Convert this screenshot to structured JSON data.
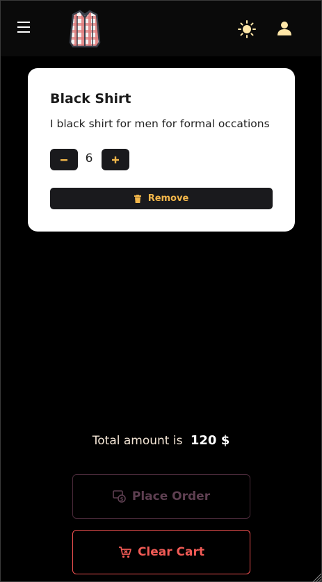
{
  "navbar": {
    "menu_icon": "hamburger-menu-icon",
    "logo_icon": "plaid-shirt-logo-icon",
    "theme_icon": "sun-icon",
    "user_icon": "user-icon"
  },
  "cart_item": {
    "title": "Black Shirt",
    "description": "I black shirt for men for formal occations",
    "quantity": "6",
    "minus_icon": "minus-icon",
    "plus_icon": "plus-icon",
    "remove_label": "Remove",
    "remove_icon": "trash-icon"
  },
  "summary": {
    "total_label": "Total amount is",
    "total_value": "120 $"
  },
  "actions": {
    "place_order_label": "Place Order",
    "place_order_icon": "money-check-icon",
    "clear_cart_label": "Clear Cart",
    "clear_cart_icon": "cart-remove-icon"
  },
  "colors": {
    "background": "#000000",
    "navbar": "#0a0a0a",
    "card": "#ffffff",
    "accent": "#f2b64a",
    "danger": "#f05a55",
    "disabled": "#5e3f51"
  }
}
